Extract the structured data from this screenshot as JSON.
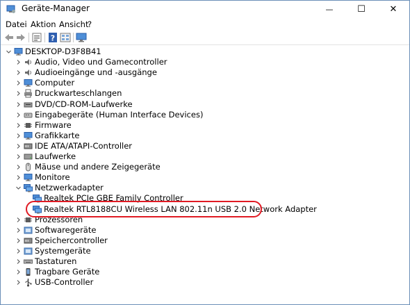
{
  "window": {
    "title": "Geräte-Manager",
    "controls": {
      "minimize": "—",
      "maximize": "☐",
      "close": "✕"
    }
  },
  "menu": [
    "Datei",
    "Aktion",
    "Ansicht",
    "?"
  ],
  "toolbar": [
    "back-arrow-icon",
    "forward-arrow-icon",
    "properties-icon",
    "help-icon",
    "view-icon",
    "monitor-icon"
  ],
  "tree": {
    "root": "DESKTOP-D3F8B41",
    "categories": [
      {
        "label": "Audio, Video und Gamecontroller",
        "icon": "speaker-icon"
      },
      {
        "label": "Audioeingänge und -ausgänge",
        "icon": "speaker-icon"
      },
      {
        "label": "Computer",
        "icon": "computer-icon"
      },
      {
        "label": "Druckwarteschlangen",
        "icon": "printer-icon"
      },
      {
        "label": "DVD/CD-ROM-Laufwerke",
        "icon": "disc-drive-icon"
      },
      {
        "label": "Eingabegeräte (Human Interface Devices)",
        "icon": "hid-icon"
      },
      {
        "label": "Firmware",
        "icon": "chip-icon"
      },
      {
        "label": "Grafikkarte",
        "icon": "display-adapter-icon"
      },
      {
        "label": "IDE ATA/ATAPI-Controller",
        "icon": "ide-icon"
      },
      {
        "label": "Laufwerke",
        "icon": "drive-icon"
      },
      {
        "label": "Mäuse und andere Zeigegeräte",
        "icon": "mouse-icon"
      },
      {
        "label": "Monitore",
        "icon": "monitor-icon"
      },
      {
        "label": "Netzwerkadapter",
        "icon": "network-icon",
        "expanded": true,
        "children": [
          {
            "label": "Realtek PCIe GBE Family Controller",
            "icon": "network-icon"
          },
          {
            "label": "Realtek RTL8188CU Wireless LAN 802.11n USB 2.0 Network Adapter",
            "icon": "network-icon",
            "highlighted": true
          }
        ]
      },
      {
        "label": "Prozessoren",
        "icon": "chip-icon"
      },
      {
        "label": "Softwaregeräte",
        "icon": "software-device-icon"
      },
      {
        "label": "Speichercontroller",
        "icon": "storage-icon"
      },
      {
        "label": "Systemgeräte",
        "icon": "system-device-icon"
      },
      {
        "label": "Tastaturen",
        "icon": "keyboard-icon"
      },
      {
        "label": "Tragbare Geräte",
        "icon": "portable-device-icon"
      },
      {
        "label": "USB-Controller",
        "icon": "usb-icon"
      }
    ]
  },
  "colors": {
    "highlight_ring": "#e01a23",
    "window_border": "#6b8fb8"
  }
}
